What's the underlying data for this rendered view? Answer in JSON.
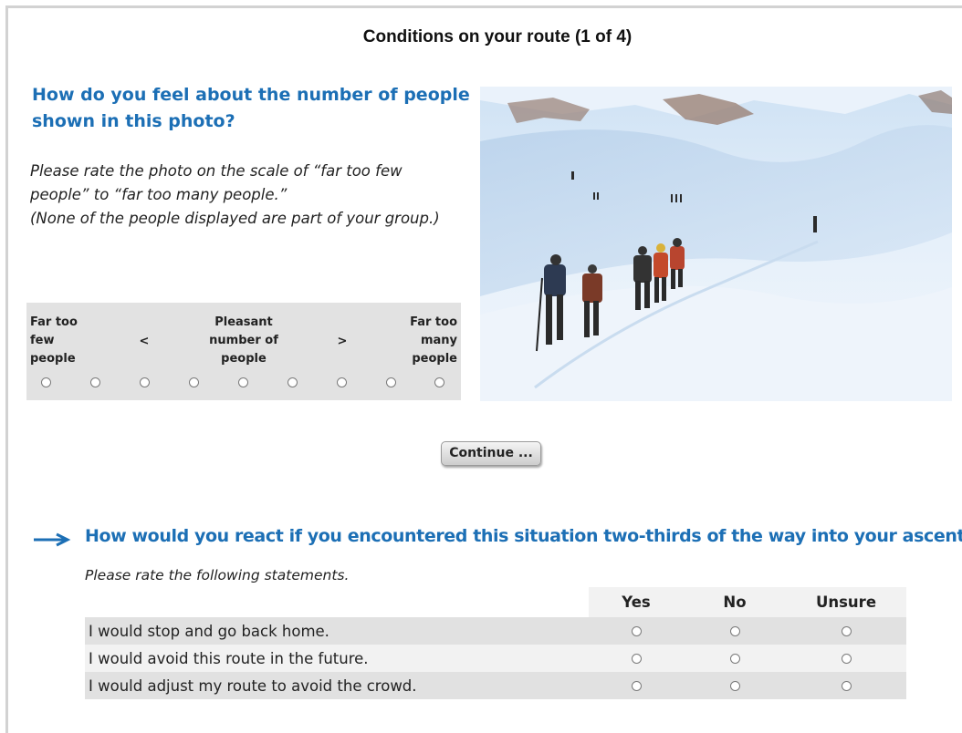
{
  "page": {
    "title": "Conditions on your route  (1 of 4)"
  },
  "question1": {
    "text": "How do you feel about the number of people shown in this photo?",
    "instruction_lines": [
      "Please rate the photo on the scale of  “far too few",
      "people” to “far too many people.”",
      "(None of the people displayed are part of your group.)"
    ],
    "scale": {
      "left_label_lines": [
        "Far too",
        "few",
        "people"
      ],
      "lt_symbol": "<",
      "middle_label_lines": [
        "Pleasant",
        "number of",
        "people"
      ],
      "gt_symbol": ">",
      "right_label_lines": [
        "Far too",
        "many",
        "people"
      ],
      "point_count": 9,
      "selected": null
    },
    "photo": {
      "icon": "ski-touring-photo",
      "colors": {
        "sky": "#dce9f6",
        "snow": "#eef5fc",
        "shadow": "#b9d1ea",
        "rock": "#8d7a73"
      }
    }
  },
  "continue_button": {
    "label": "Continue ..."
  },
  "question2": {
    "arrow_icon": "arrow-right-icon",
    "text": "How would you react if you encountered this situation two-thirds of the way into your ascent?",
    "instruction": "Please rate the following statements.",
    "columns": [
      "Yes",
      "No",
      "Unsure"
    ],
    "statements": [
      {
        "text": "I would stop and go back home.",
        "selected": null
      },
      {
        "text": "I would avoid this route in the future.",
        "selected": null
      },
      {
        "text": "I would adjust my route to avoid the crowd.",
        "selected": null
      }
    ]
  },
  "colors": {
    "accent": "#1c6fb5",
    "scale_bg": "#e2e2e2",
    "row_dark": "#e1e1e1",
    "row_light": "#f2f2f2"
  }
}
